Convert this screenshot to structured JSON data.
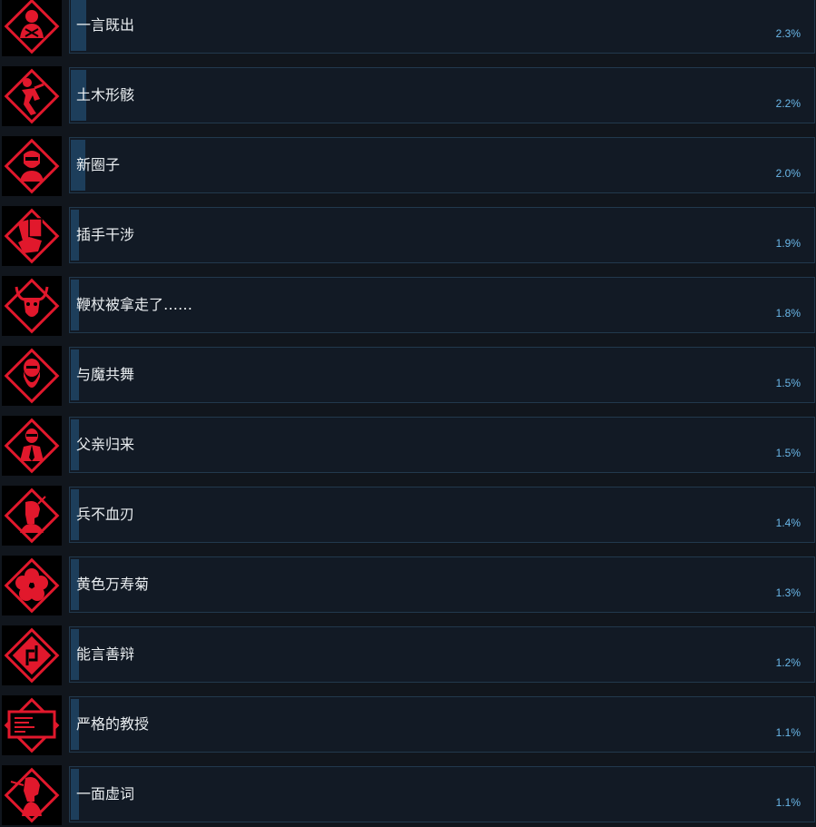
{
  "colors": {
    "background": "#11161d",
    "bar_background": "#121a25",
    "bar_border": "#22394d",
    "bar_fill": "#1d3e5b",
    "name_text": "#e9edf0",
    "percent_text": "#6ab7e8",
    "icon_red": "#e1182c"
  },
  "achievements": [
    {
      "name": "一言既出",
      "percent": "2.3%",
      "unlock_percent": 2.3,
      "icon": "armored-figure-icon"
    },
    {
      "name": "土木形骸",
      "percent": "2.2%",
      "unlock_percent": 2.2,
      "icon": "running-figure-icon"
    },
    {
      "name": "新圈子",
      "percent": "2.0%",
      "unlock_percent": 2.0,
      "icon": "masked-man-icon"
    },
    {
      "name": "插手干涉",
      "percent": "1.9%",
      "unlock_percent": 1.9,
      "icon": "cards-hand-icon"
    },
    {
      "name": "鞭杖被拿走了……",
      "percent": "1.8%",
      "unlock_percent": 1.8,
      "icon": "horned-bull-icon"
    },
    {
      "name": "与魔共舞",
      "percent": "1.5%",
      "unlock_percent": 1.5,
      "icon": "bearded-man-icon"
    },
    {
      "name": "父亲归来",
      "percent": "1.5%",
      "unlock_percent": 1.5,
      "icon": "suited-man-icon"
    },
    {
      "name": "兵不血刃",
      "percent": "1.4%",
      "unlock_percent": 1.4,
      "icon": "profile-head-icon"
    },
    {
      "name": "黄色万寿菊",
      "percent": "1.3%",
      "unlock_percent": 1.3,
      "icon": "flower-icon"
    },
    {
      "name": "能言善辩",
      "percent": "1.2%",
      "unlock_percent": 1.2,
      "icon": "arrows-diamond-icon"
    },
    {
      "name": "严格的教授",
      "percent": "1.1%",
      "unlock_percent": 1.1,
      "icon": "chalkboard-icon"
    },
    {
      "name": "一面虚词",
      "percent": "1.1%",
      "unlock_percent": 1.1,
      "icon": "speaking-woman-icon"
    }
  ]
}
